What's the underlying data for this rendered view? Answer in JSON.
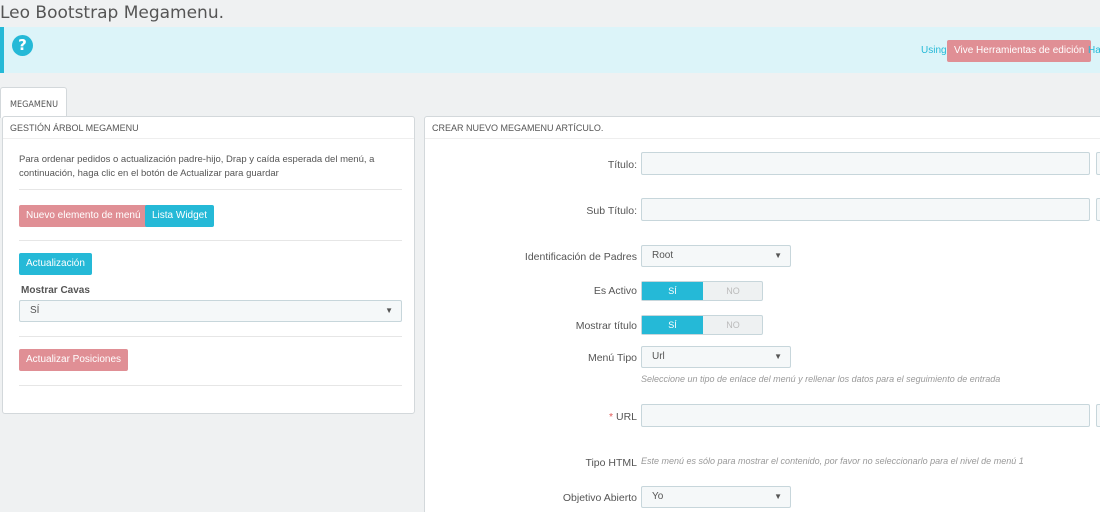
{
  "page": {
    "title": "Leo Bootstrap Megamenu."
  },
  "help_bar": {
    "icon": "question-circle-icon",
    "using_text": "Using",
    "live_button": "Vive Herramientas de edición",
    "trailing_text": "Hac"
  },
  "tab": {
    "label": "MEGAMENU"
  },
  "left_panel": {
    "heading": "GESTIÓN ÁRBOL MEGAMENU",
    "description": "Para ordenar pedidos o actualización padre-hijo, Drap y caída esperada del menú, a continuación, haga clic en el botón de Actualizar para guardar",
    "new_item_button": "Nuevo elemento de menú",
    "widget_list_button": "Lista Widget",
    "update_button": "Actualización",
    "show_canvas_label": "Mostrar Cavas",
    "show_canvas_value": "SÍ",
    "update_positions_button": "Actualizar Posiciones"
  },
  "right_panel": {
    "heading": "CREAR NUEVO MEGAMENU ARTÍCULO.",
    "title_label": "Título:",
    "title_value": "",
    "subtitle_label": "Sub Título:",
    "subtitle_value": "",
    "parent_label": "Identificación de Padres",
    "parent_value": "Root",
    "active_label": "Es Activo",
    "active_yes": "SÍ",
    "active_no": "NO",
    "show_title_label": "Mostrar título",
    "show_title_yes": "SÍ",
    "show_title_no": "NO",
    "menu_type_label": "Menú Tipo",
    "menu_type_value": "Url",
    "menu_type_help": "Seleccione un tipo de enlace del menú y rellenar los datos para el seguimiento de entrada",
    "url_required": "*",
    "url_label": "URL",
    "url_value": "",
    "html_type_label": "Tipo HTML",
    "html_type_help": "Este menú es sólo para mostrar el contenido, por favor no seleccionarlo para el nivel de menú 1",
    "target_label": "Objetivo Abierto",
    "target_value": "Yo"
  },
  "colors": {
    "accent": "#25b9d7",
    "danger_button": "#e08f95",
    "help_bg": "#dcf4f9"
  }
}
